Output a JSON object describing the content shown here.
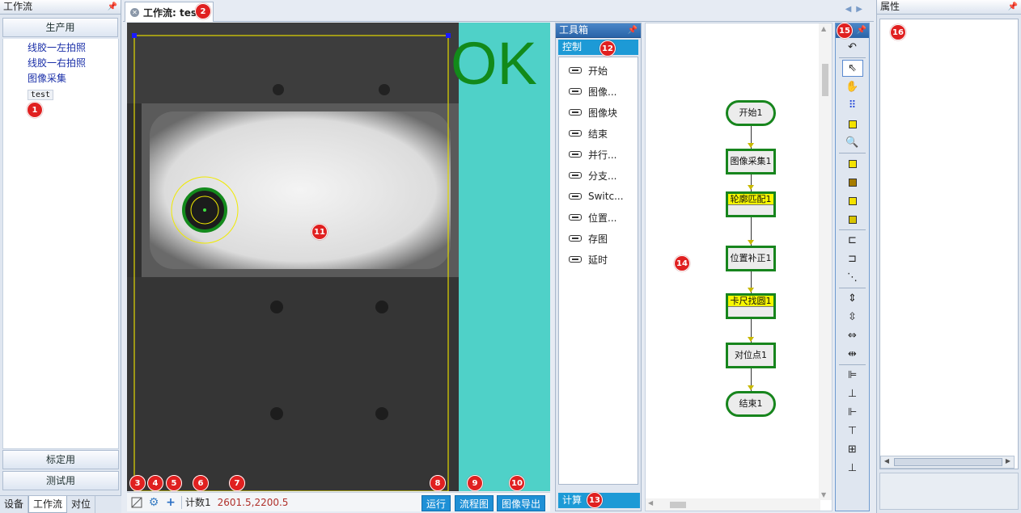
{
  "left": {
    "title": "工作流",
    "group_top": "生产用",
    "items": [
      "线胶一左拍照",
      "线胶一右拍照",
      "图像采集",
      "test"
    ],
    "group_calib": "标定用",
    "group_test": "测试用",
    "tabs": [
      "设备",
      "工作流",
      "对位"
    ]
  },
  "doc": {
    "tab_title": "工作流: test"
  },
  "image_view": {
    "status_text": "OK",
    "counter_label": "计数1",
    "coords": "2601.5,2200.5",
    "btn_run": "运行",
    "btn_flow": "流程图",
    "btn_export": "图像导出"
  },
  "toolbox": {
    "title": "工具箱",
    "category_control": "控制",
    "tools": [
      "开始",
      "图像...",
      "图像块",
      "结束",
      "并行...",
      "分支...",
      "Switc...",
      "位置...",
      "存图",
      "延时"
    ],
    "category_calc": "计算"
  },
  "flow": {
    "nodes": [
      {
        "label": "开始1",
        "kind": "terminal"
      },
      {
        "label": "图像采集1",
        "kind": "normal"
      },
      {
        "label": "轮廓匹配1",
        "kind": "error"
      },
      {
        "label": "位置补正1",
        "kind": "normal"
      },
      {
        "label": "卡尺找圆1",
        "kind": "error"
      },
      {
        "label": "对位点1",
        "kind": "normal"
      },
      {
        "label": "结束1",
        "kind": "terminal"
      }
    ]
  },
  "properties": {
    "title": "属性"
  },
  "badges": [
    "1",
    "2",
    "3",
    "4",
    "5",
    "6",
    "7",
    "8",
    "9",
    "10",
    "11",
    "12",
    "13",
    "14",
    "15",
    "16"
  ],
  "colors": {
    "accent": "#1d9ad6",
    "ok_green": "#128a1a",
    "node_border": "#17851d",
    "badge_red": "#e02020",
    "view_bg": "#4fd1c8"
  }
}
